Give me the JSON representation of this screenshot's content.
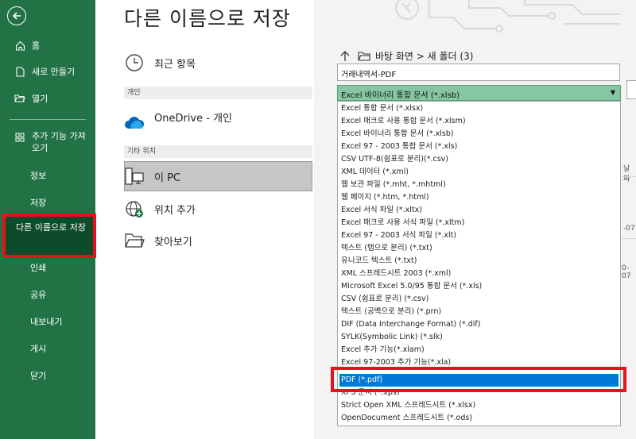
{
  "sidebar": {
    "items": [
      {
        "label": "홈",
        "icon": "home-icon"
      },
      {
        "label": "새로 만들기",
        "icon": "new-document-icon"
      },
      {
        "label": "열기",
        "icon": "folder-open-icon"
      },
      {
        "label": "추가 기능 가져오기",
        "icon": "addin-grid-icon"
      },
      {
        "label": "정보"
      },
      {
        "label": "저장"
      },
      {
        "label": "다른 이름으로 저장"
      },
      {
        "label": "인쇄"
      },
      {
        "label": "공유"
      },
      {
        "label": "내보내기"
      },
      {
        "label": "게시"
      },
      {
        "label": "닫기"
      }
    ]
  },
  "page": {
    "title": "다른 이름으로 저장"
  },
  "locations": {
    "recent": "최근 항목",
    "personal_header": "개인",
    "onedrive": "OneDrive - 개인",
    "onedrive_email": "",
    "other_header": "기타 위치",
    "this_pc": "이 PC",
    "add_place": "위치 추가",
    "browse": "찾아보기"
  },
  "save_panel": {
    "breadcrumb": "바탕 화면 > 새 폴더 (3)",
    "filename": "거래내역서-PDF",
    "file_type_selected": "Excel 바이너리 통합 문서 (*.xlsb)",
    "file_types": [
      "Excel 통합 문서 (*.xlsx)",
      "Excel 매크로 사용 통합 문서 (*.xlsm)",
      "Excel 바이너리 통합 문서 (*.xlsb)",
      "Excel 97 - 2003 통합 문서 (*.xls)",
      "CSV UTF-8(쉼표로 분리)(*.csv)",
      "XML 데이터 (*.xml)",
      "웹 보관 파일 (*.mht, *.mhtml)",
      "웹 페이지 (*.htm, *.html)",
      "Excel 서식 파일 (*.xltx)",
      "Excel 매크로 사용 서식 파일 (*.xltm)",
      "Excel 97 - 2003 서식 파일 (*.xlt)",
      "텍스트 (탭으로 분리) (*.txt)",
      "유니코드 텍스트 (*.txt)",
      "XML 스프레드시트 2003 (*.xml)",
      "Microsoft Excel 5.0/95 통합 문서 (*.xls)",
      "CSV (쉼표로 분리) (*.csv)",
      "텍스트 (공백으로 분리) (*.prn)",
      "DIF (Data Interchange Format) (*.dif)",
      "SYLK(Symbolic Link) (*.slk)",
      "Excel 추가 기능(*.xlam)",
      "Excel 97-2003 추가 기능(*.xla)",
      "PDF (*.pdf)",
      "XPS 문서 (*.xps)",
      "Strict Open XML 스프레드시트 (*.xlsx)",
      "OpenDocument 스프레드시트 (*.ods)"
    ],
    "highlighted_index": 21,
    "peek_header": "날짜",
    "peek_date1": "-07",
    "peek_date2": "0-07"
  },
  "colors": {
    "sidebar_green": "#217346",
    "selected_blue": "#0078d7",
    "highlight_red": "#e8101a",
    "select_green": "#87c6a2"
  }
}
